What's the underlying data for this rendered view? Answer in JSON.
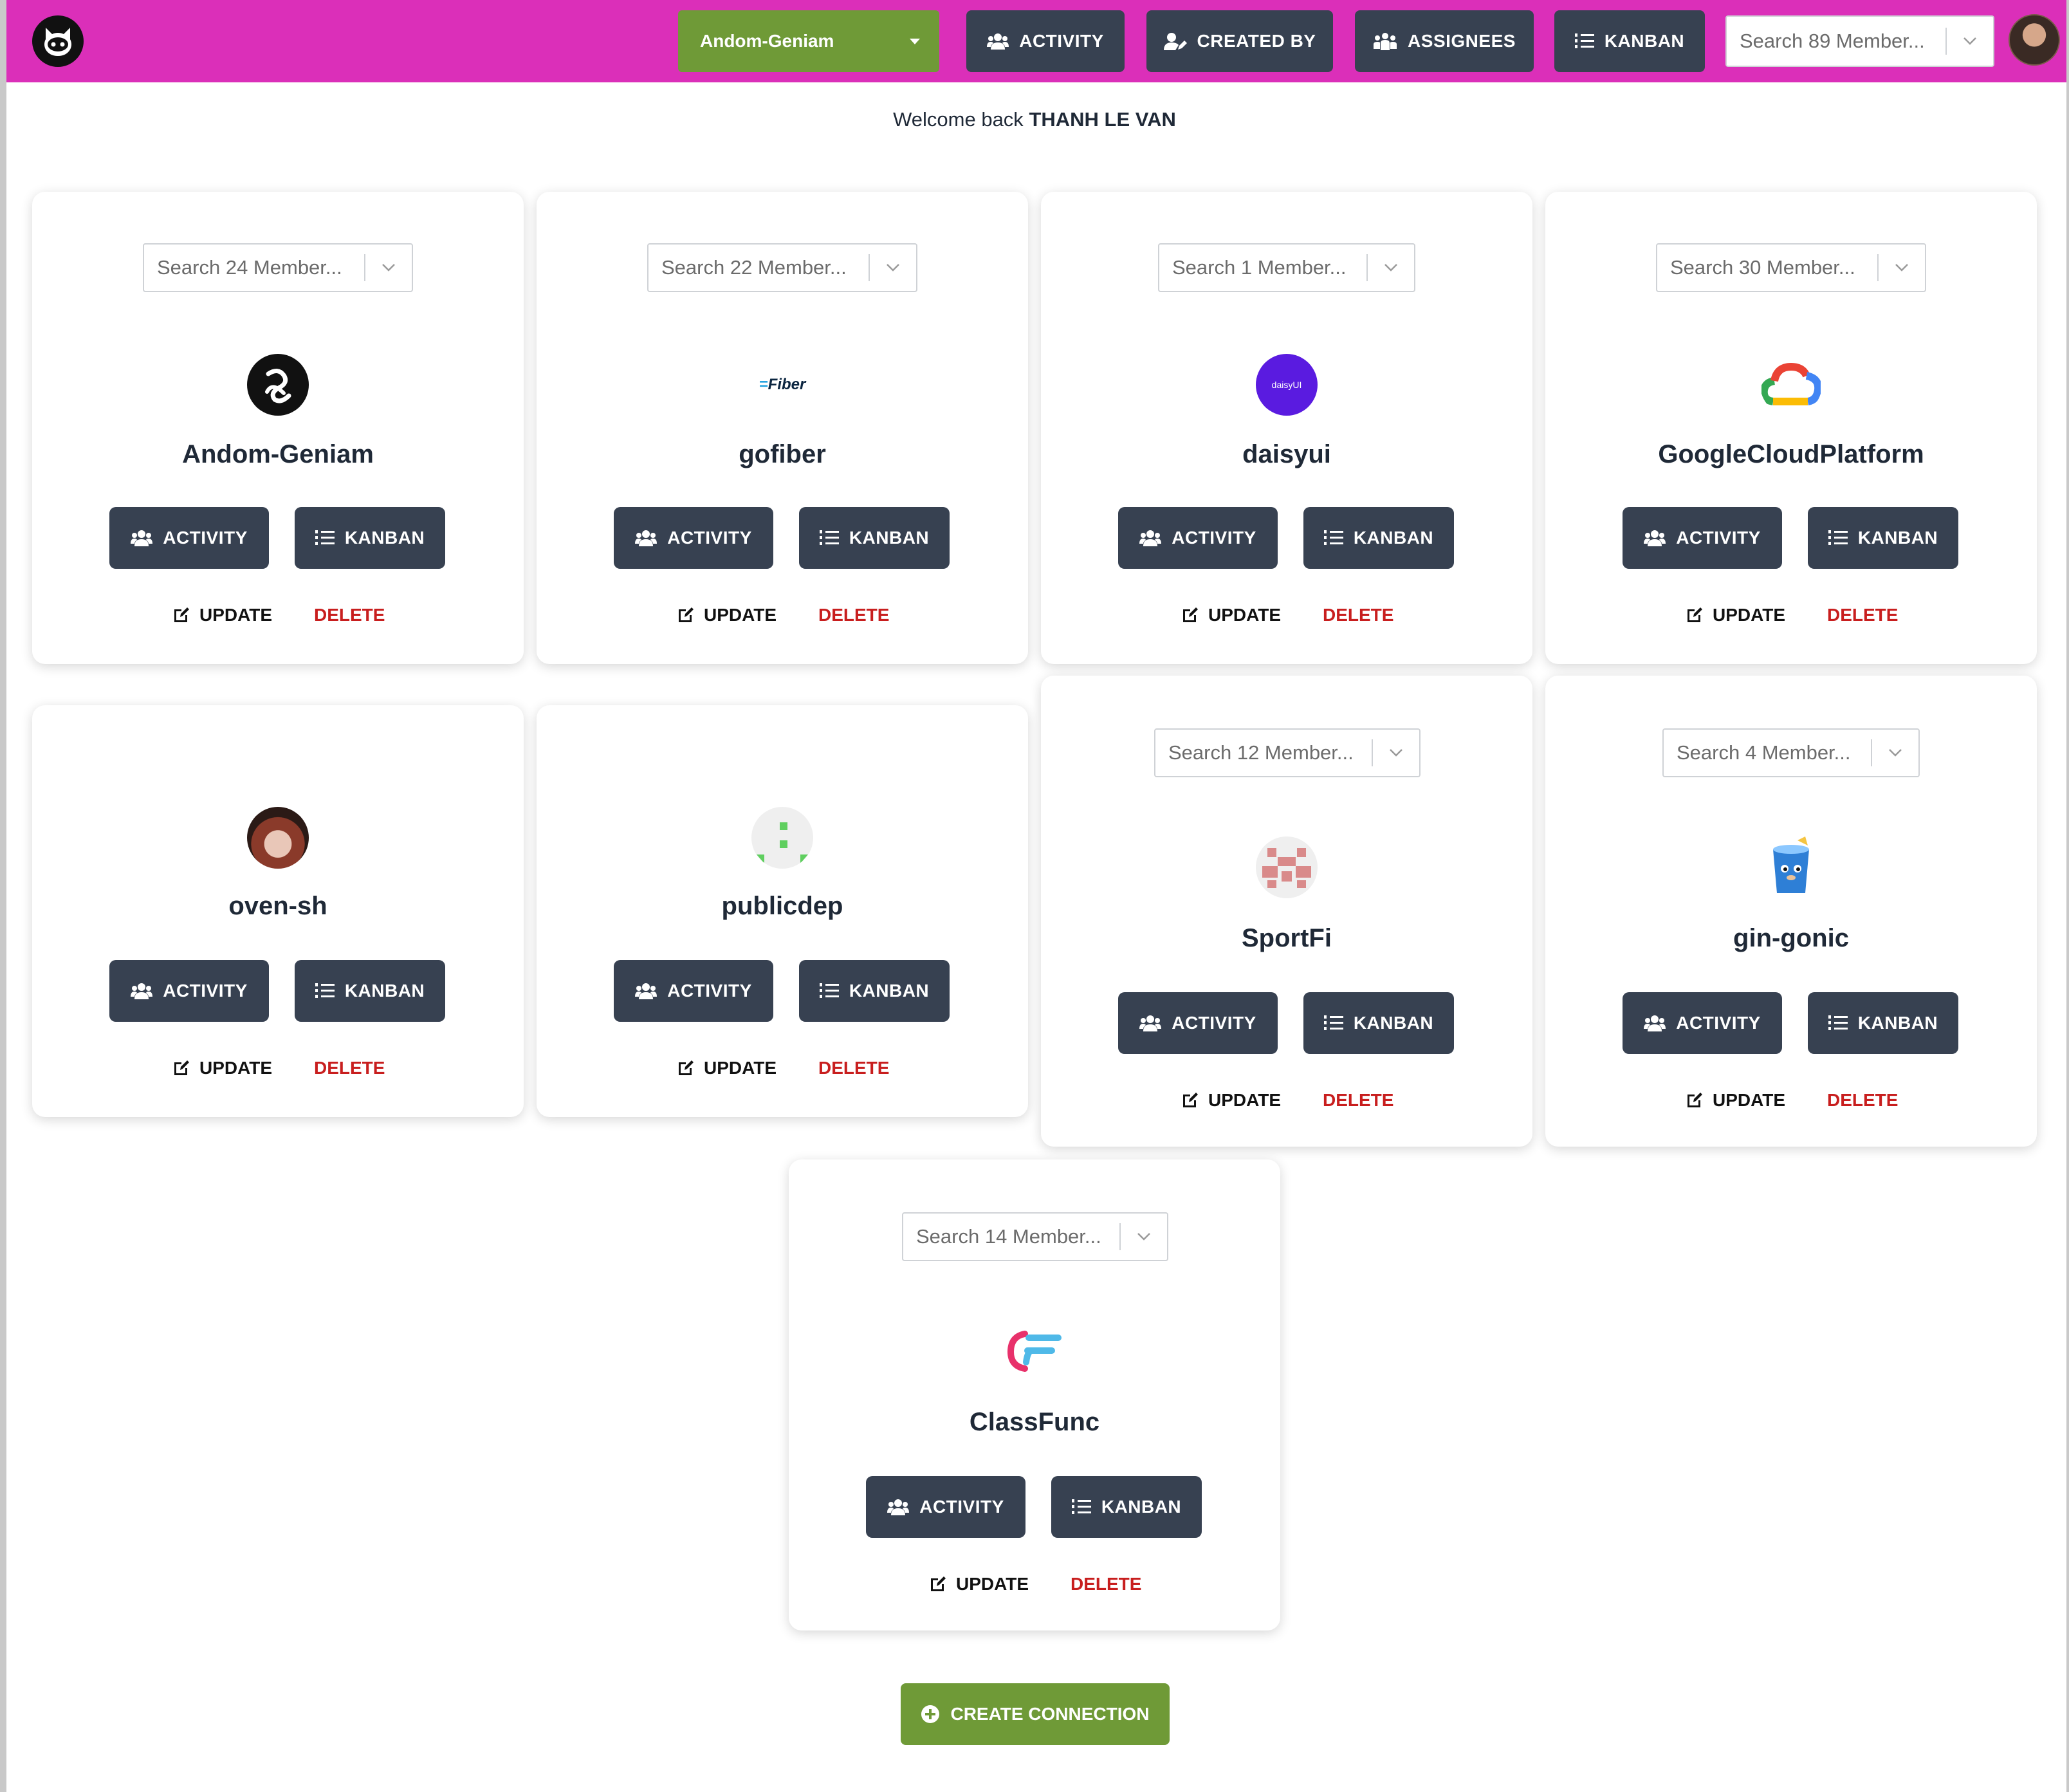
{
  "header": {
    "logo_icon": "github-cat-icon",
    "org_select": "Andom-Geniam",
    "nav": [
      {
        "label": "ACTIVITY",
        "icon": "users-icon"
      },
      {
        "label": "CREATED BY",
        "icon": "user-edit-icon"
      },
      {
        "label": "ASSIGNEES",
        "icon": "people-group-icon"
      },
      {
        "label": "KANBAN",
        "icon": "list-ordered-icon"
      }
    ],
    "member_search_placeholder": "Search 89 Member...",
    "avatar": "user-avatar"
  },
  "welcome": {
    "prefix": "Welcome back",
    "name": "THANH LE VAN"
  },
  "cards": [
    {
      "name": "Andom-Geniam",
      "search": "Search 24 Member...",
      "logo": "andom-geniam-logo"
    },
    {
      "name": "gofiber",
      "search": "Search 22 Member...",
      "logo": "fiber-logo",
      "logo_text": "Fiber"
    },
    {
      "name": "daisyui",
      "search": "Search 1 Member...",
      "logo": "daisyui-logo",
      "logo_text": "daisyUI"
    },
    {
      "name": "GoogleCloudPlatform",
      "search": "Search 30 Member...",
      "logo": "google-cloud-logo"
    },
    {
      "name": "oven-sh",
      "search": "",
      "logo": "oven-sh-logo"
    },
    {
      "name": "publicdep",
      "search": "",
      "logo": "publicdep-identicon"
    },
    {
      "name": "SportFi",
      "search": "Search 12 Member...",
      "logo": "sportfi-identicon"
    },
    {
      "name": "gin-gonic",
      "search": "Search 4 Member...",
      "logo": "gin-gonic-logo"
    },
    {
      "name": "ClassFunc",
      "search": "Search 14 Member...",
      "logo": "classfunc-logo"
    }
  ],
  "card_actions": {
    "activity": "ACTIVITY",
    "kanban": "KANBAN",
    "update": "UPDATE",
    "delete": "DELETE"
  },
  "create_button": "CREATE CONNECTION",
  "colors": {
    "header": "#db2fb9",
    "accent_green": "#6f9a37",
    "button_dark": "#374151",
    "delete_red": "#c81e1e"
  }
}
